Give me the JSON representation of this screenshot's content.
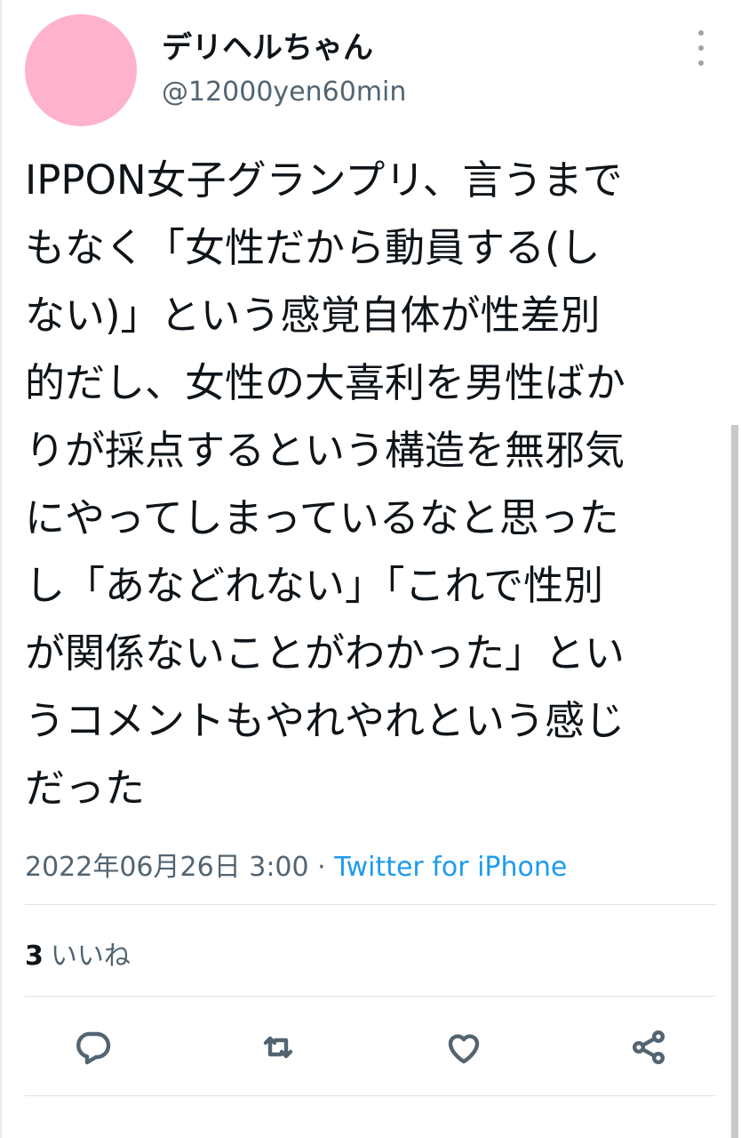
{
  "user": {
    "display_name": "デリヘルちゃん",
    "handle": "@12000yen60min"
  },
  "tweet": {
    "lines": [
      "IPPON女子グランプリ、言うまで",
      "もなく「女性だから動員する(し",
      "ない)」という感覚自体が性差別",
      "的だし、女性の大喜利を男性ばか",
      "りが採点するという構造を無邪気",
      "にやってしまっているなと思った",
      "し「あなどれない」「これで性別",
      "が関係ないことがわかった」とい",
      "うコメントもやれやれという感じ",
      "だった"
    ],
    "timestamp": "2022年06月26日 3:00",
    "separator": " · ",
    "source": "Twitter for iPhone"
  },
  "stats": {
    "likes_count": "3",
    "likes_label": "いいね"
  },
  "actions": {
    "reply_icon": "reply-icon",
    "retweet_icon": "retweet-icon",
    "like_icon": "heart-icon",
    "share_icon": "share-icon"
  },
  "colors": {
    "avatar": "#ffb2cc",
    "text": "#0f1419",
    "secondary": "#536471",
    "link": "#1d9bf0"
  }
}
